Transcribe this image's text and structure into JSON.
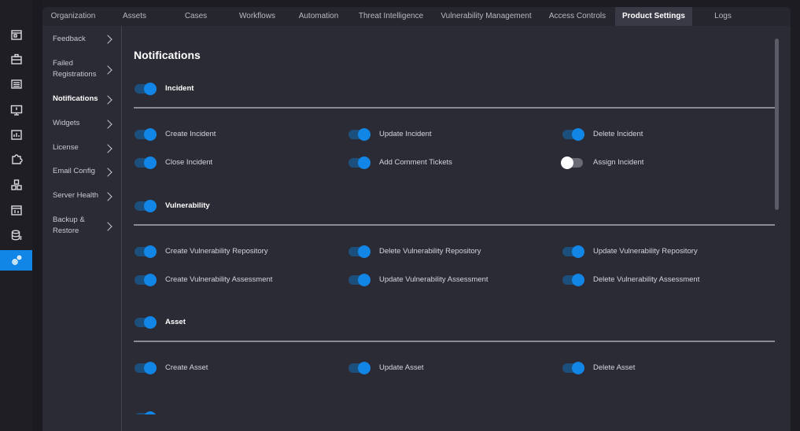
{
  "rail": {
    "icons": [
      "calendar-icon",
      "briefcase-icon",
      "list-window-icon",
      "monitor-alert-icon",
      "chart-icon",
      "puzzle-icon",
      "cubes-icon",
      "dashboard-icon",
      "database-icon",
      "settings-gears-icon"
    ]
  },
  "tabs": [
    "Organization",
    "Assets",
    "Cases",
    "Workflows",
    "Automation",
    "Threat Intelligence",
    "Vulnerability Management",
    "Access Controls",
    "Product Settings",
    "Logs"
  ],
  "active_tab": "Product Settings",
  "sidebar": {
    "items": [
      {
        "label": "Feedback"
      },
      {
        "label": "Failed Registrations"
      },
      {
        "label": "Notifications"
      },
      {
        "label": "Widgets"
      },
      {
        "label": "License"
      },
      {
        "label": "Email Config"
      },
      {
        "label": "Server Health"
      },
      {
        "label": "Backup & Restore"
      }
    ]
  },
  "main": {
    "title": "Notifications",
    "groups": [
      {
        "label": "Incident",
        "enabled": true,
        "items": [
          {
            "label": "Create Incident",
            "enabled": true
          },
          {
            "label": "Update Incident",
            "enabled": true
          },
          {
            "label": "Delete Incident",
            "enabled": true
          },
          {
            "label": "Close Incident",
            "enabled": true
          },
          {
            "label": "Add Comment Tickets",
            "enabled": true
          },
          {
            "label": "Assign Incident",
            "enabled": false
          }
        ]
      },
      {
        "label": "Vulnerability",
        "enabled": true,
        "items": [
          {
            "label": "Create Vulnerability Repository",
            "enabled": true
          },
          {
            "label": "Delete Vulnerability Repository",
            "enabled": true
          },
          {
            "label": "Update Vulnerability Repository",
            "enabled": true
          },
          {
            "label": "Create Vulnerability Assessment",
            "enabled": true
          },
          {
            "label": "Update Vulnerability Assessment",
            "enabled": true
          },
          {
            "label": "Delete Vulnerability Assessment",
            "enabled": true
          }
        ]
      },
      {
        "label": "Asset",
        "enabled": true,
        "items": [
          {
            "label": "Create Asset",
            "enabled": true
          },
          {
            "label": "Update Asset",
            "enabled": true
          },
          {
            "label": "Delete Asset",
            "enabled": true
          }
        ]
      }
    ]
  },
  "colors": {
    "accent": "#1186e6",
    "toggle_track_on": "#1d4f7c",
    "panel": "#2b2b35"
  }
}
